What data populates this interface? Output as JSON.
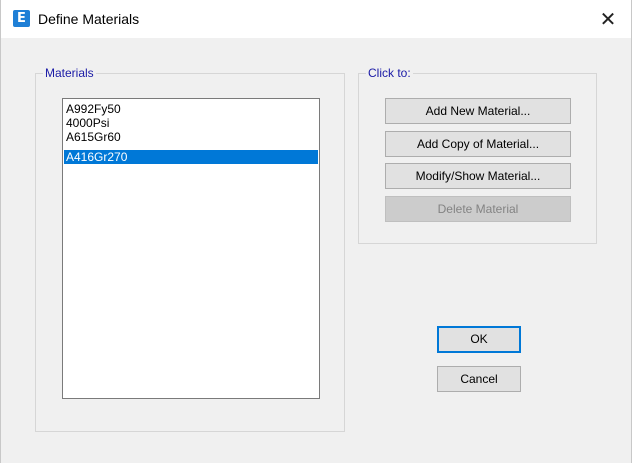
{
  "window": {
    "title": "Define Materials",
    "icon_letter": "E",
    "close_glyph": "✕"
  },
  "materials": {
    "legend": "Materials",
    "items": [
      {
        "label": "A992Fy50",
        "selected": false
      },
      {
        "label": "4000Psi",
        "selected": false
      },
      {
        "label": "A615Gr60",
        "selected": false
      },
      {
        "label": "A416Gr270",
        "selected": true
      }
    ]
  },
  "click_to": {
    "legend": "Click to:",
    "add_new": "Add New Material...",
    "add_copy": "Add Copy of Material...",
    "modify_show": "Modify/Show Material...",
    "delete": "Delete Material"
  },
  "buttons": {
    "ok": "OK",
    "cancel": "Cancel"
  },
  "colors": {
    "selection": "#0078d7",
    "legend_text": "#1a1aa6",
    "app_icon": "#1e7fd6"
  }
}
